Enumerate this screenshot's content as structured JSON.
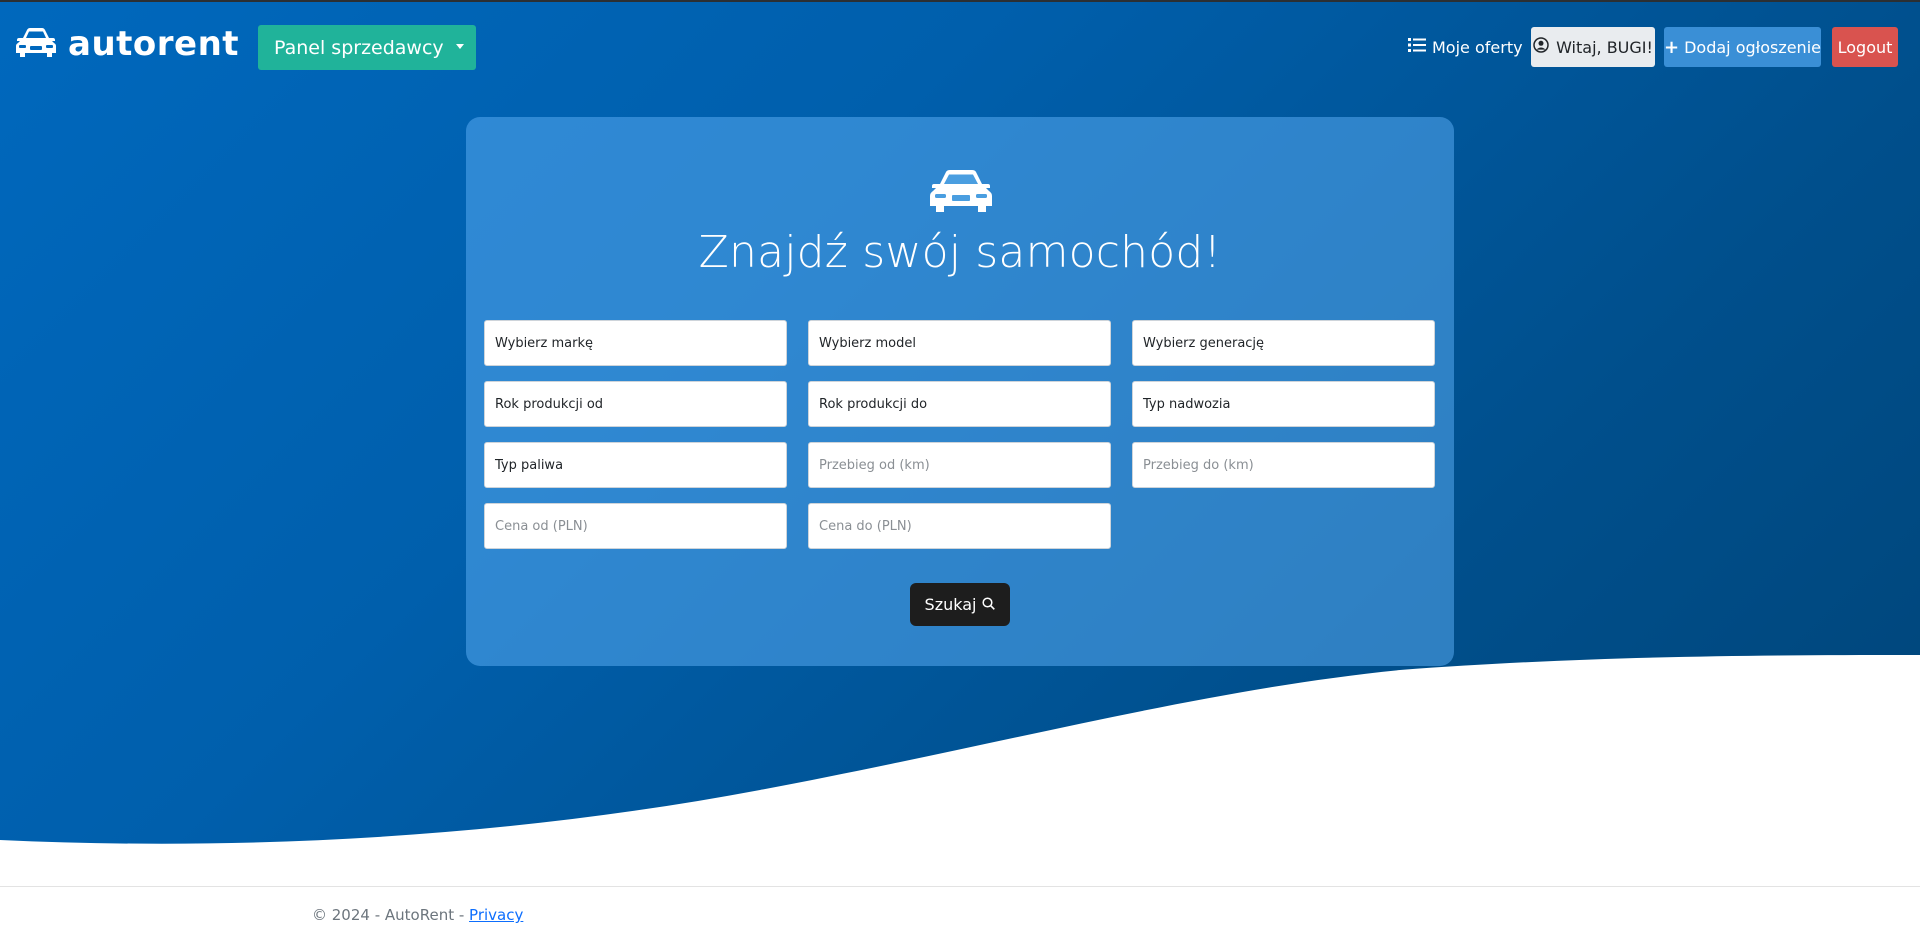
{
  "brand": {
    "name": "autorent",
    "logo_icon": "car-front-icon"
  },
  "navbar": {
    "panel_dropdown": "Panel sprzedawcy",
    "my_offers": "Moje oferty",
    "greeting": "Witaj, BUGI!",
    "add_listing": "Dodaj ogłoszenie",
    "logout": "Logout"
  },
  "search": {
    "title": "Znajdź swój samochód!",
    "icon": "car-front-icon",
    "fields": {
      "make": "Wybierz markę",
      "model": "Wybierz model",
      "generation": "Wybierz generację",
      "year_from": "Rok produkcji od",
      "year_to": "Rok produkcji do",
      "body_type": "Typ nadwozia",
      "fuel_type": "Typ paliwa",
      "mileage_from": "Przebieg od (km)",
      "mileage_to": "Przebieg do (km)",
      "price_from": "Cena od (PLN)",
      "price_to": "Cena do (PLN)"
    },
    "button": "Szukaj"
  },
  "footer": {
    "copyright": "© 2024 - AutoRent - ",
    "privacy": "Privacy"
  },
  "colors": {
    "accent_teal": "#20b39a",
    "primary_blue": "#3a8fd6",
    "danger": "#d9534f",
    "hero_blue": "#0068bd"
  }
}
